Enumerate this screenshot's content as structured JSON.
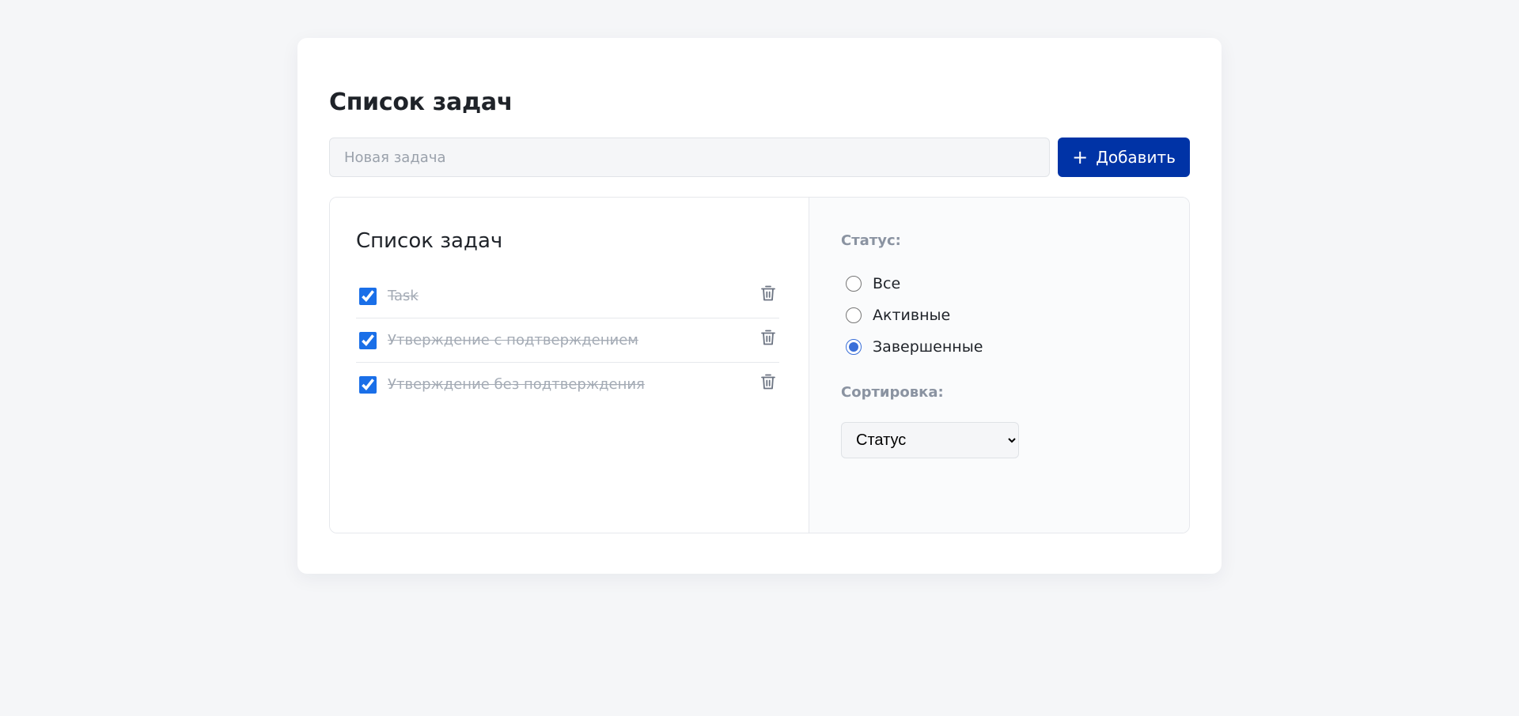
{
  "app": {
    "title": "Список задач"
  },
  "add_form": {
    "input_value": "",
    "input_placeholder": "Новая задача",
    "add_label": "Добавить",
    "add_icon": "plus-icon"
  },
  "list": {
    "title": "Список задач",
    "items": [
      {
        "text": "Task",
        "completed": true
      },
      {
        "text": "Утверждение с подтверждением",
        "completed": true
      },
      {
        "text": "Утверждение без подтверждения",
        "completed": true
      }
    ],
    "delete_icon": "trash-icon"
  },
  "filters": {
    "status_label": "Статус:",
    "status_options": [
      {
        "label": "Все",
        "selected": false
      },
      {
        "label": "Активные",
        "selected": false
      },
      {
        "label": "Завершенные",
        "selected": true
      }
    ],
    "sort_label": "Сортировка:",
    "sort_selected": "Статус"
  },
  "colors": {
    "accent": "#0033a6",
    "checkbox": "#1a6fe8",
    "radio": "#3a6fd8",
    "muted_text": "#a4abb5",
    "background": "#f5f6f8"
  }
}
